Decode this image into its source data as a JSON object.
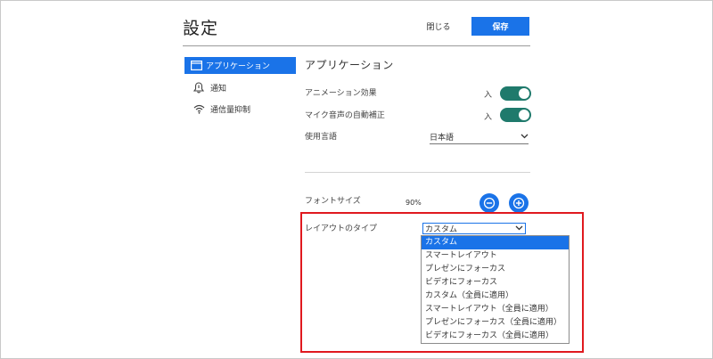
{
  "header": {
    "title": "設定",
    "close_label": "閉じる",
    "save_label": "保存"
  },
  "sidebar": {
    "items": [
      {
        "label": "アプリケーション",
        "icon": "window-icon",
        "active": true
      },
      {
        "label": "通知",
        "icon": "bell-icon",
        "active": false
      },
      {
        "label": "通信量抑制",
        "icon": "wifi-icon",
        "active": false
      }
    ]
  },
  "main": {
    "section_title": "アプリケーション",
    "animation": {
      "label": "アニメーション効果",
      "state": "入",
      "on": true
    },
    "mic_correction": {
      "label": "マイク音声の自動補正",
      "state": "入",
      "on": true
    },
    "language": {
      "label": "使用言語",
      "value": "日本語"
    },
    "font_size": {
      "label": "フォントサイズ",
      "value": "90%"
    },
    "layout_type": {
      "label": "レイアウトのタイプ",
      "value": "カスタム",
      "options": [
        "カスタム",
        "スマートレイアウト",
        "プレゼンにフォーカス",
        "ビデオにフォーカス",
        "カスタム（全員に適用）",
        "スマートレイアウト（全員に適用）",
        "プレゼンにフォーカス（全員に適用）",
        "ビデオにフォーカス（全員に適用）"
      ],
      "selected_index": 0
    }
  },
  "colors": {
    "accent": "#1a73e8",
    "toggle_on": "#1f7a6c",
    "highlight": "#e0191f"
  }
}
